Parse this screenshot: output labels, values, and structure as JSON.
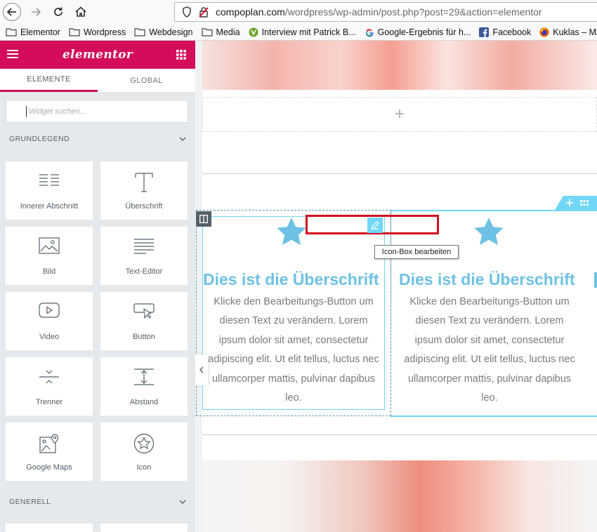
{
  "browser": {
    "url_domain": "compoplan.com",
    "url_path": "/wordpress/wp-admin/post.php?post=29&action=elementor"
  },
  "bookmarks": [
    {
      "label": "Elementor",
      "icon": "folder-icon"
    },
    {
      "label": "Wordpress",
      "icon": "folder-icon"
    },
    {
      "label": "Webdesign",
      "icon": "folder-icon"
    },
    {
      "label": "Media",
      "icon": "folder-icon"
    },
    {
      "label": "Interview mit Patrick B...",
      "icon": "v-logo-icon"
    },
    {
      "label": "Google-Ergebnis für h...",
      "icon": "google-icon"
    },
    {
      "label": "Facebook",
      "icon": "facebook-icon"
    },
    {
      "label": "Kuklas – MADAM",
      "icon": "firefox-icon"
    }
  ],
  "panel": {
    "logo": "elementor",
    "tabs": [
      "ELEMENTE",
      "GLOBAL"
    ],
    "search_placeholder": "Widget suchen...",
    "categories": {
      "basic": "GRUNDLEGEND",
      "general": "GENERELL"
    },
    "widgets": [
      {
        "label": "Innerer Abschnitt",
        "icon": "inner-section-icon"
      },
      {
        "label": "Überschrift",
        "icon": "heading-icon"
      },
      {
        "label": "Bild",
        "icon": "image-icon"
      },
      {
        "label": "Text-Editor",
        "icon": "text-editor-icon"
      },
      {
        "label": "Video",
        "icon": "video-icon"
      },
      {
        "label": "Button",
        "icon": "button-icon"
      },
      {
        "label": "Trenner",
        "icon": "divider-icon"
      },
      {
        "label": "Abstand",
        "icon": "spacer-icon"
      },
      {
        "label": "Google Maps",
        "icon": "google-maps-icon"
      },
      {
        "label": "Icon",
        "icon": "star-icon"
      }
    ]
  },
  "canvas": {
    "add_section_symbol": "+",
    "boxes": [
      {
        "title": "Dies ist die Überschrift",
        "text_lines": [
          "Klicke den Bearbeitungs-Button um",
          "diesen Text zu verändern. Lorem",
          "ipsum dolor sit amet, consectetur",
          "adipiscing elit. Ut elit tellus, luctus nec",
          "ullamcorper mattis, pulvinar dapibus",
          "leo."
        ]
      },
      {
        "title": "Dies ist die Überschrift",
        "text_lines": [
          "Klicke den Bearbeitungs-Button um",
          "diesen Text zu verändern. Lorem",
          "ipsum dolor sit amet, consectetur",
          "adipiscing elit. Ut elit tellus, luctus nec",
          "ullamcorper mattis, pulvinar dapibus",
          "leo."
        ]
      }
    ],
    "tooltip": "Icon-Box bearbeiten"
  },
  "colors": {
    "elementor_pink": "#d30c5c",
    "accent_blue": "#6ec1e4",
    "handle_blue": "#71d7f7",
    "highlight_red": "#d3101f"
  }
}
